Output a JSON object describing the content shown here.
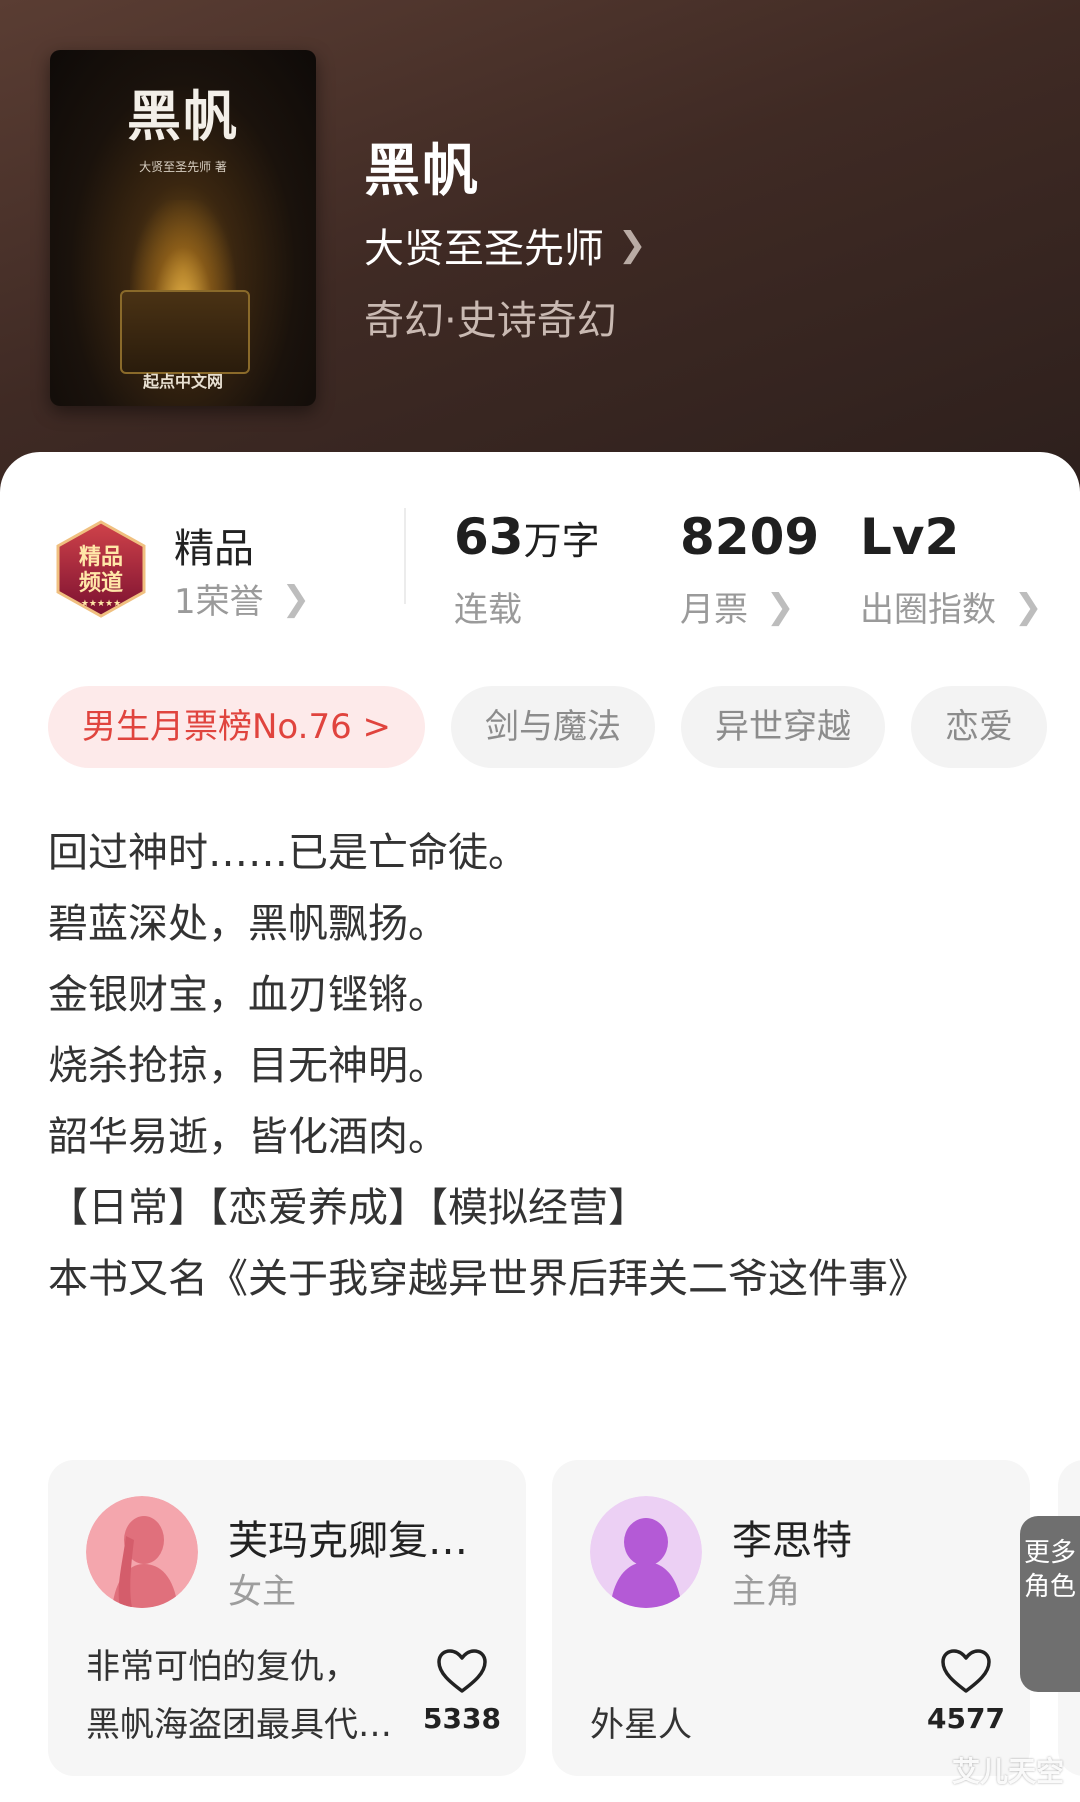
{
  "book": {
    "cover": {
      "title": "黑帆",
      "author_line": "大贤至圣先师 著",
      "publisher": "起点中文网"
    },
    "title": "黑帆",
    "author": "大贤至圣先师",
    "genre": "奇幻·史诗奇幻"
  },
  "stats": {
    "quality": {
      "label": "精品",
      "honor": "1荣誉",
      "badge_text": "精品频道"
    },
    "words": {
      "value": "63",
      "unit": "万字",
      "label": "连载"
    },
    "tickets": {
      "value": "8209",
      "label": "月票"
    },
    "circle": {
      "value": "Lv2",
      "label": "出圈指数"
    }
  },
  "tags": [
    {
      "label": "男生月票榜No.76 >",
      "type": "rank"
    },
    {
      "label": "剑与魔法",
      "type": "normal"
    },
    {
      "label": "异世穿越",
      "type": "normal"
    },
    {
      "label": "恋爱",
      "type": "normal"
    }
  ],
  "synopsis": [
    "回过神时……已是亡命徒。",
    "碧蓝深处，黑帆飘扬。",
    "金银财宝，血刃铿锵。",
    "烧杀抢掠，目无神明。",
    "韶华易逝，皆化酒肉。",
    "【日常】【恋爱养成】【模拟经营】",
    "本书又名《关于我穿越异世界后拜关二爷这件事》"
  ],
  "characters": [
    {
      "name": "芙玛克卿复…",
      "role": "女主",
      "desc_1": "非常可怕的复仇，",
      "desc_2": "黑帆海盗团最具代…",
      "likes": "5338"
    },
    {
      "name": "李思特",
      "role": "主角",
      "desc_1": "外星人",
      "likes": "4577"
    }
  ],
  "more_roles": "更多角色",
  "watermark": "艾儿天空",
  "colors": {
    "accent": "#e0443e",
    "header_bg": "#4a322b"
  }
}
